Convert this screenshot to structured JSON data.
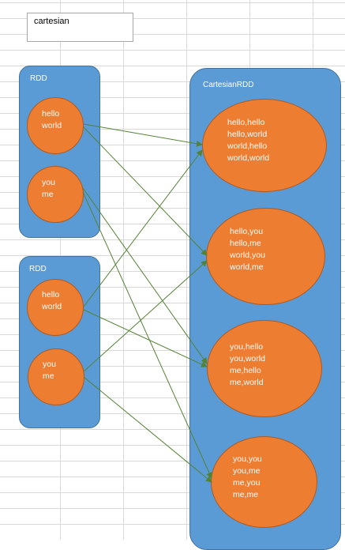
{
  "title": "cartesian",
  "inputs": [
    {
      "label": "RDD",
      "items": [
        "hello\nworld",
        "you\nme"
      ]
    },
    {
      "label": "RDD",
      "items": [
        "hello\nworld",
        "you\nme"
      ]
    }
  ],
  "output": {
    "label": "CartesianRDD",
    "items": [
      "hello,hello\nhello,world\nworld,hello\nworld,world",
      "hello,you\nhello,me\nworld,you\nworld,me",
      "you,hello\nyou,world\nme,hello\nme,world",
      "you,you\nyou,me\nme,you\nme,me"
    ]
  },
  "colors": {
    "container": "#5b9bd5",
    "ellipse": "#ed7d31",
    "arrow": "#548235"
  }
}
